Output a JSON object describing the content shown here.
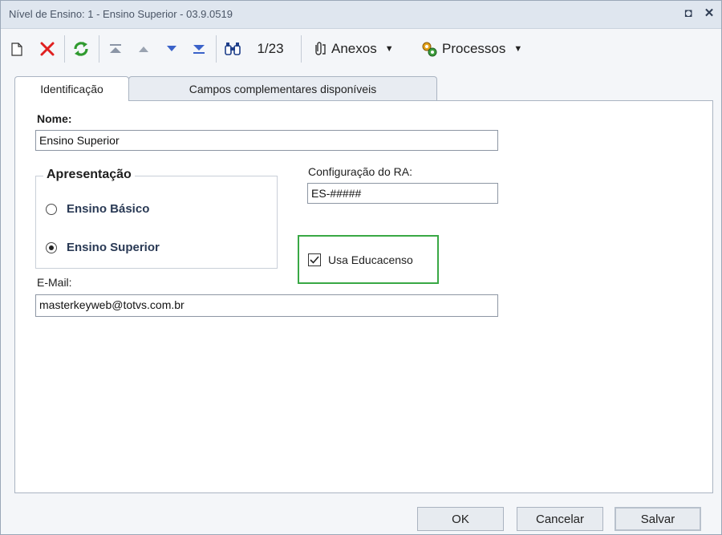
{
  "window": {
    "title": "Nível de Ensino: 1 - Ensino Superior - 03.9.0519",
    "restore_glyph": "◘",
    "close_glyph": "✕"
  },
  "toolbar": {
    "record_position": "1/23",
    "attachments_label": "Anexos",
    "processes_label": "Processos"
  },
  "tabs": [
    {
      "label": "Identificação",
      "active": true
    },
    {
      "label": "Campos complementares disponíveis",
      "active": false
    }
  ],
  "form": {
    "nome_label": "Nome:",
    "nome_value": "Ensino Superior",
    "presentation_title": "Apresentação",
    "radio_options": [
      {
        "label": "Ensino Básico",
        "selected": false
      },
      {
        "label": "Ensino Superior",
        "selected": true
      }
    ],
    "ra_label": "Configuração do RA:",
    "ra_value": "ES-#####",
    "educacenso_label": "Usa Educacenso",
    "educacenso_checked": true,
    "email_label": "E-Mail:",
    "email_value": "masterkeyweb@totvs.com.br"
  },
  "buttons": {
    "ok": "OK",
    "cancel": "Cancelar",
    "save": "Salvar"
  },
  "colors": {
    "focus_border": "#39a845",
    "delete_red": "#e02020",
    "refresh_green": "#2f9a2f",
    "nav_blue": "#3a62c9"
  }
}
